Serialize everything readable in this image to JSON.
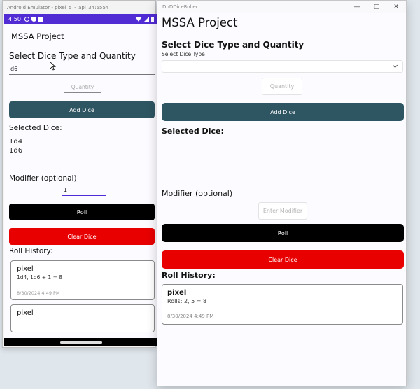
{
  "emulator": {
    "window_title": "Android Emulator - pixel_5_-_api_34:5554",
    "status": {
      "time": "4:50"
    },
    "app_title": "MSSA Project",
    "select_heading": "Select Dice Type and Quantity",
    "dice_type_value": "d6",
    "quantity_placeholder": "Quantity",
    "add_dice_label": "Add Dice",
    "selected_dice_label": "Selected Dice:",
    "selected_dice": [
      "1d4",
      "1d6"
    ],
    "modifier_label": "Modifier (optional)",
    "modifier_value": "1",
    "roll_label": "Roll",
    "clear_label": "Clear Dice",
    "history_label": "Roll History:",
    "history": [
      {
        "name": "pixel",
        "result": "1d4, 1d6 + 1 = 8",
        "timestamp": "8/30/2024 4:49 PM"
      },
      {
        "name": "pixel"
      }
    ]
  },
  "desktop": {
    "window_title": "DnDDiceRoller",
    "app_title": "MSSA Project",
    "select_heading": "Select Dice Type and Quantity",
    "dice_type_label": "Select Dice Type",
    "dice_type_value": "",
    "quantity_placeholder": "Quantity",
    "add_dice_label": "Add Dice",
    "selected_dice_label": "Selected Dice:",
    "modifier_label": "Modifier (optional)",
    "modifier_placeholder": "Enter Modifier",
    "roll_label": "Roll",
    "clear_label": "Clear Dice",
    "history_label": "Roll History:",
    "history": [
      {
        "name": "pixel",
        "result": "Rolls: 2, 5 = 8",
        "timestamp": "8/30/2024 4:49 PM"
      }
    ]
  },
  "colors": {
    "status_bar": "#512bd4",
    "add_button": "#2e5562",
    "roll_button": "#000000",
    "clear_button": "#e80000"
  }
}
